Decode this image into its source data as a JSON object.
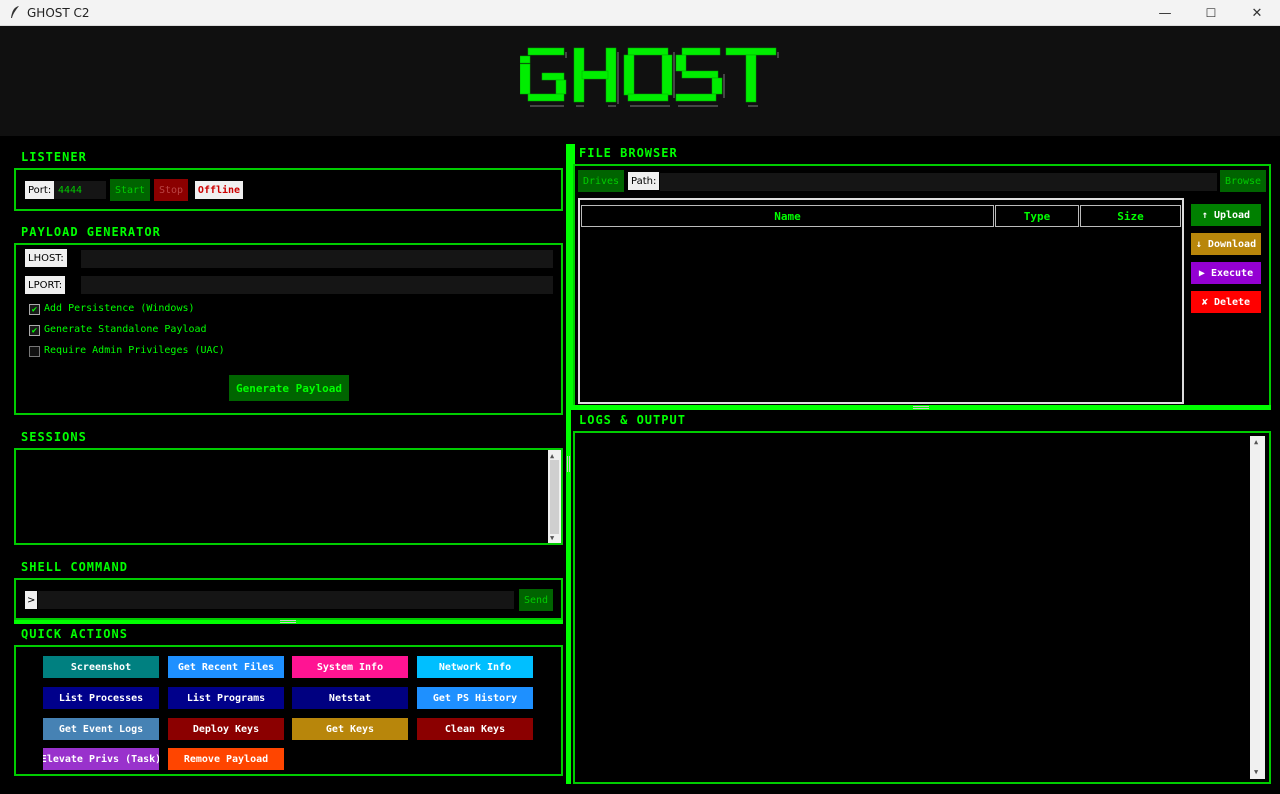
{
  "window": {
    "title": "GHOST C2",
    "minimize": "—",
    "maximize": "☐",
    "close": "✕"
  },
  "banner": {
    "logo_text": "GHOST"
  },
  "listener": {
    "title": "LISTENER",
    "port_label": "Port:",
    "port_value": "4444",
    "start_label": "Start",
    "stop_label": "Stop",
    "status": "Offline"
  },
  "payload": {
    "title": "PAYLOAD GENERATOR",
    "lhost_label": "LHOST:",
    "lhost_value": "",
    "lport_label": "LPORT:",
    "lport_value": "",
    "options": [
      {
        "label": "Add Persistence (Windows)",
        "checked": true
      },
      {
        "label": "Generate Standalone Payload",
        "checked": true
      },
      {
        "label": "Require Admin Privileges (UAC)",
        "checked": false
      }
    ],
    "generate_label": "Generate Payload"
  },
  "sessions": {
    "title": "SESSIONS"
  },
  "shell": {
    "title": "SHELL COMMAND",
    "prompt": ">",
    "value": "",
    "send_label": "Send"
  },
  "quick_actions": {
    "title": "QUICK ACTIONS",
    "buttons": [
      {
        "label": "Screenshot",
        "color": "#008080"
      },
      {
        "label": "Get Recent Files",
        "color": "#1e90ff"
      },
      {
        "label": "System Info",
        "color": "#ff1493"
      },
      {
        "label": "Network Info",
        "color": "#00bfff"
      },
      {
        "label": "List Processes",
        "color": "#00008b"
      },
      {
        "label": "List Programs",
        "color": "#00008b"
      },
      {
        "label": "Netstat",
        "color": "#000080"
      },
      {
        "label": "Get PS History",
        "color": "#1e90ff"
      },
      {
        "label": "Get Event Logs",
        "color": "#4682b4"
      },
      {
        "label": "Deploy Keys",
        "color": "#8b0000"
      },
      {
        "label": "Get Keys",
        "color": "#b8860b"
      },
      {
        "label": "Clean Keys",
        "color": "#8b0000"
      },
      {
        "label": "Elevate Privs (Task)",
        "color": "#9932cc"
      },
      {
        "label": "Remove Payload",
        "color": "#ff4500"
      }
    ]
  },
  "file_browser": {
    "title": "FILE BROWSER",
    "drives_label": "Drives",
    "path_label": "Path:",
    "path_value": "",
    "browse_label": "Browse",
    "columns": [
      "Name",
      "Type",
      "Size"
    ],
    "actions": [
      {
        "label": "↑ Upload",
        "color": "#008000"
      },
      {
        "label": "↓ Download",
        "color": "#b8860b"
      },
      {
        "label": "▶ Execute",
        "color": "#9400d3"
      },
      {
        "label": "✘ Delete",
        "color": "#ff0000"
      }
    ]
  },
  "logs": {
    "title": "LOGS & OUTPUT"
  },
  "colors": {
    "accent": "#00ff00",
    "background": "#000000",
    "banner": "#101010"
  }
}
